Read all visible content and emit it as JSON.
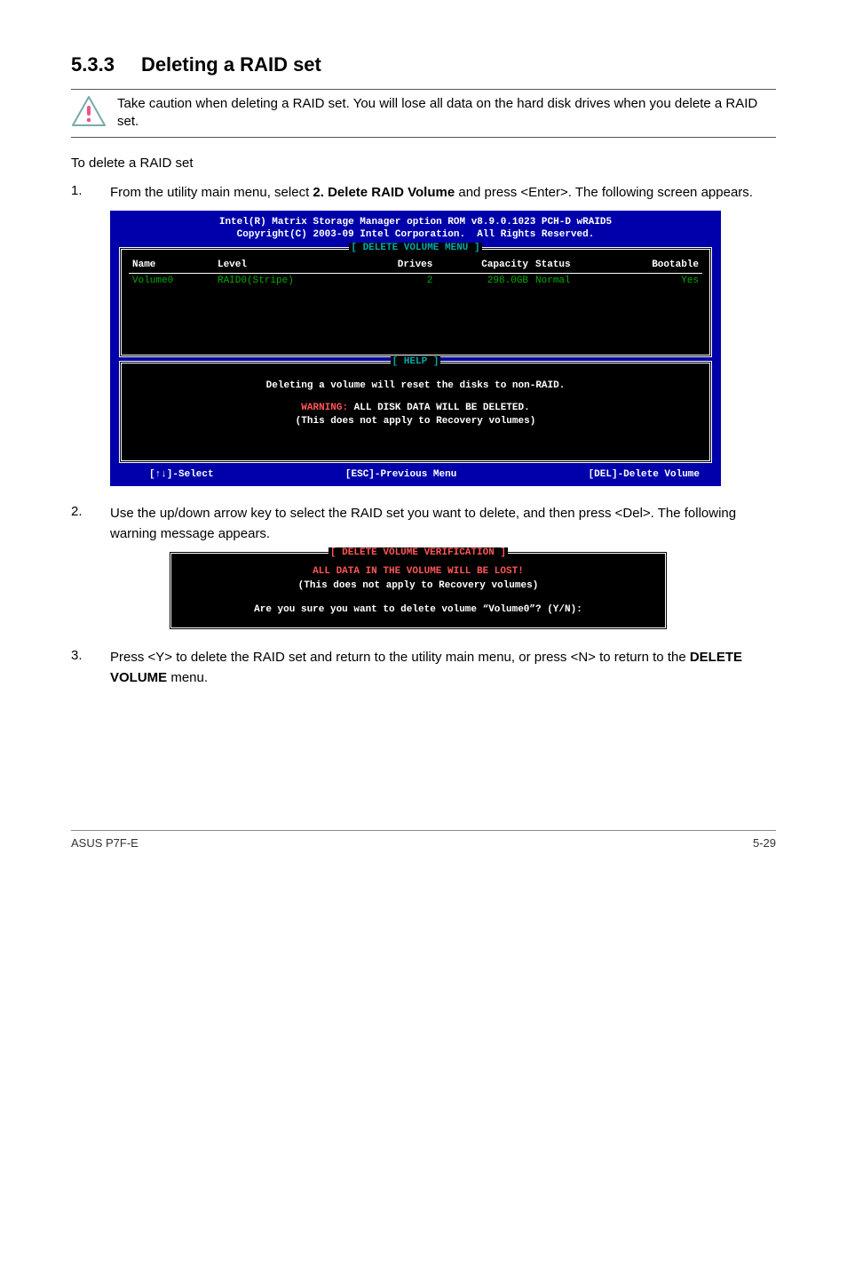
{
  "heading": {
    "number": "5.3.3",
    "title": "Deleting a RAID set"
  },
  "caution": "Take caution when deleting a RAID set. You will lose all data on the hard disk drives when you delete a RAID set.",
  "intro": "To delete a RAID set",
  "step1": {
    "num": "1.",
    "text_a": "From the utility main menu, select ",
    "bold": "2. Delete RAID Volume",
    "text_b": " and press <Enter>. The following screen appears."
  },
  "bios": {
    "header_l1": "Intel(R) Matrix Storage Manager option ROM v8.9.0.1023 PCH-D wRAID5",
    "header_l2": "Copyright(C) 2003-09 Intel Corporation.  All Rights Reserved.",
    "delete_menu_title": "[ DELETE VOLUME MENU ]",
    "cols": {
      "name": "Name",
      "level": "Level",
      "drives": "Drives",
      "capacity": "Capacity",
      "status": "Status",
      "bootable": "Bootable"
    },
    "row": {
      "name": "Volume0",
      "level": "RAID0(Stripe)",
      "drives": "2",
      "capacity": "298.0GB",
      "status": "Normal",
      "bootable": "Yes"
    },
    "help_title": "[ HELP ]",
    "help_l1": "Deleting a volume will reset the disks to non-RAID.",
    "help_warn_prefix": "WARNING:",
    "help_warn_rest": " ALL DISK DATA WILL BE DELETED.",
    "help_l3": "(This does not apply to Recovery volumes)",
    "footer_select": "[↑↓]-Select",
    "footer_esc": "[ESC]-Previous Menu",
    "footer_del": "[DEL]-Delete Volume"
  },
  "step2": {
    "num": "2.",
    "text": "Use the up/down arrow key to select the RAID set you want to delete, and then press <Del>. The following warning message appears."
  },
  "verify": {
    "title": "[ DELETE VOLUME VERIFICATION ]",
    "l1": "ALL DATA IN THE VOLUME WILL BE LOST!",
    "l2": "(This does not apply to Recovery volumes)",
    "l3": "Are you sure you want to delete volume “Volume0”? (Y/N):"
  },
  "step3": {
    "num": "3.",
    "text_a": "Press <Y> to delete the RAID set and return to the utility main menu, or press <N> to return to the ",
    "bold": "DELETE VOLUME",
    "text_b": " menu."
  },
  "footer": {
    "left": "ASUS P7F-E",
    "right": "5-29"
  }
}
